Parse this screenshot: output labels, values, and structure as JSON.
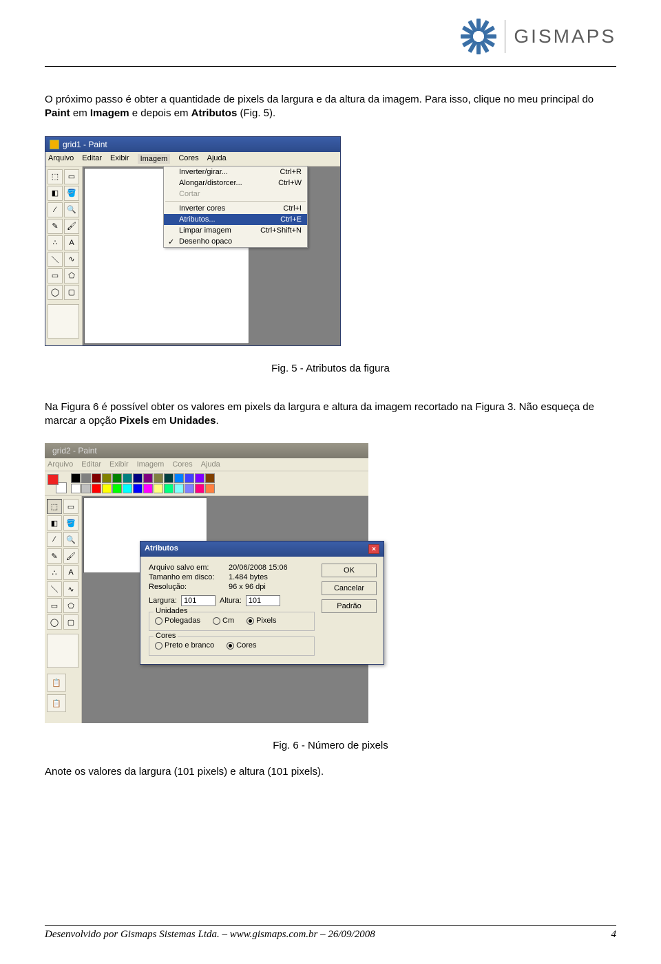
{
  "header": {
    "brand": "GISMAPS"
  },
  "para1_pre": "O próximo passo é obter a quantidade de pixels da largura e da altura da imagem. Para isso, clique no meu principal do ",
  "para1_b1": "Paint",
  "para1_mid": " em ",
  "para1_b2": "Imagem",
  "para1_mid2": " e depois em ",
  "para1_b3": "Atributos",
  "para1_end": " (Fig. 5).",
  "fig5": {
    "title": "grid1 - Paint",
    "menus": [
      "Arquivo",
      "Editar",
      "Exibir",
      "Imagem",
      "Cores",
      "Ajuda"
    ],
    "dropdown": [
      {
        "label": "Inverter/girar...",
        "short": "Ctrl+R"
      },
      {
        "label": "Alongar/distorcer...",
        "short": "Ctrl+W"
      },
      {
        "label": "Cortar",
        "short": "",
        "disabled": true
      },
      {
        "sep": true
      },
      {
        "label": "Inverter cores",
        "short": "Ctrl+I"
      },
      {
        "label": "Atributos...",
        "short": "Ctrl+E",
        "hl": true
      },
      {
        "label": "Limpar imagem",
        "short": "Ctrl+Shift+N"
      },
      {
        "label": "Desenho opaco",
        "short": "",
        "check": true
      }
    ],
    "caption": "Fig. 5 - Atributos da figura"
  },
  "para2_pre": "Na Figura 6 é possível obter os valores em pixels da largura e altura da imagem recortado na Figura 3. Não esqueça de marcar a opção ",
  "para2_b1": "Pixels",
  "para2_mid": " em ",
  "para2_b2": "Unidades",
  "para2_end": ".",
  "fig6": {
    "title": "grid2 - Paint",
    "menus": [
      "Arquivo",
      "Editar",
      "Exibir",
      "Imagem",
      "Cores",
      "Ajuda"
    ],
    "palette_row1": [
      "#000",
      "#808080",
      "#800000",
      "#808000",
      "#008000",
      "#008080",
      "#000080",
      "#800080",
      "#808040",
      "#004040",
      "#0080ff",
      "#4040ff",
      "#8000ff",
      "#804000"
    ],
    "palette_row2": [
      "#fff",
      "#c0c0c0",
      "#ff0000",
      "#ffff00",
      "#00ff00",
      "#00ffff",
      "#0000ff",
      "#ff00ff",
      "#ffff80",
      "#00ff80",
      "#80ffff",
      "#8080ff",
      "#ff0080",
      "#ff8040"
    ],
    "dialog": {
      "title": "Atributos",
      "saved_lbl": "Arquivo salvo em:",
      "saved_val": "20/06/2008 15:06",
      "size_lbl": "Tamanho em disco:",
      "size_val": "1.484 bytes",
      "res_lbl": "Resolução:",
      "res_val": "96 x 96 dpi",
      "width_lbl": "Largura:",
      "width_val": "101",
      "height_lbl": "Altura:",
      "height_val": "101",
      "units_title": "Unidades",
      "units": [
        "Polegadas",
        "Cm",
        "Pixels"
      ],
      "colors_title": "Cores",
      "colors": [
        "Preto e branco",
        "Cores"
      ],
      "btn_ok": "OK",
      "btn_cancel": "Cancelar",
      "btn_default": "Padrão"
    },
    "caption": "Fig. 6 - Número de pixels"
  },
  "para3": "Anote os valores da largura (101 pixels) e altura (101 pixels).",
  "footer": {
    "left": "Desenvolvido por Gismaps Sistemas Ltda. – www.gismaps.com.br – 26/09/2008",
    "right": "4"
  }
}
